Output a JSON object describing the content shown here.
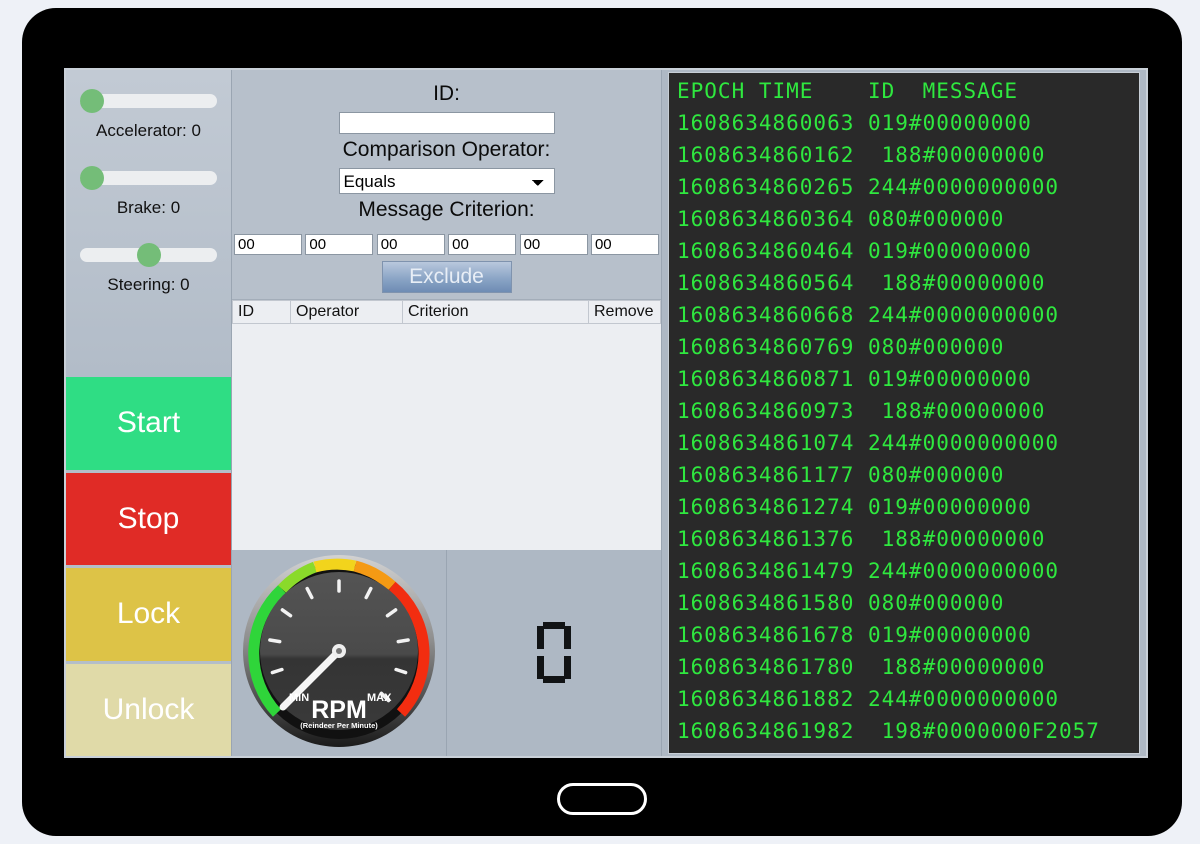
{
  "device": {
    "frame": "tablet-bezel",
    "home_button": "home-button"
  },
  "controls": {
    "sliders": [
      {
        "name": "accelerator",
        "label": "Accelerator: 0",
        "value": 0,
        "thumb_percent": 0
      },
      {
        "name": "brake",
        "label": "Brake: 0",
        "value": 0,
        "thumb_percent": 0
      },
      {
        "name": "steering",
        "label": "Steering: 0",
        "value": 0,
        "thumb_percent": 50
      }
    ],
    "buttons": [
      {
        "name": "start",
        "label": "Start",
        "color": "#2fdd84"
      },
      {
        "name": "stop",
        "label": "Stop",
        "color": "#e02b26"
      },
      {
        "name": "lock",
        "label": "Lock",
        "color": "#ddc347"
      },
      {
        "name": "unlock",
        "label": "Unlock",
        "color": "#e0daa8"
      }
    ]
  },
  "filter_form": {
    "id_label": "ID:",
    "id_value": "",
    "id_placeholder": "",
    "operator_label": "Comparison Operator:",
    "operator_value": "Equals",
    "operator_options": [
      "Equals"
    ],
    "criterion_label": "Message Criterion:",
    "byte_values": [
      "00",
      "00",
      "00",
      "00",
      "00",
      "00"
    ],
    "exclude_label": "Exclude"
  },
  "criteria_table": {
    "headers": [
      "ID",
      "Operator",
      "Criterion",
      "Remove"
    ],
    "rows": []
  },
  "gauge": {
    "title": "RPM",
    "subtitle": "(Reindeer Per Minute)",
    "min_label": "MIN",
    "max_label": "MAX",
    "value": 0,
    "needle_angle_deg": 225
  },
  "digit_display": {
    "value": "0"
  },
  "terminal": {
    "header": "EPOCH TIME    ID  MESSAGE",
    "text_color": "#2fe83f",
    "background_color": "#292929",
    "lines": [
      "1608634860063 019#00000000",
      "1608634860162  188#00000000",
      "1608634860265 244#0000000000",
      "1608634860364 080#000000",
      "1608634860464 019#00000000",
      "1608634860564  188#00000000",
      "1608634860668 244#0000000000",
      "1608634860769 080#000000",
      "1608634860871 019#00000000",
      "1608634860973  188#00000000",
      "1608634861074 244#0000000000",
      "1608634861177 080#000000",
      "1608634861274 019#00000000",
      "1608634861376  188#00000000",
      "1608634861479 244#0000000000",
      "1608634861580 080#000000",
      "1608634861678 019#00000000",
      "1608634861780  188#00000000",
      "1608634861882 244#0000000000",
      "1608634861982  198#0000000F2057"
    ]
  }
}
